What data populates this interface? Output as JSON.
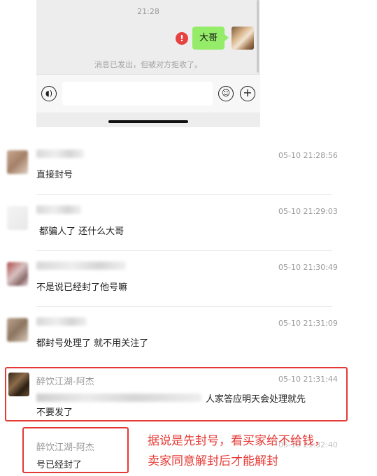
{
  "chat_preview": {
    "time": "21:28",
    "message": "大哥",
    "reject_note": "消息已发出，但被对方拒收了。",
    "icons": [
      "warning-icon",
      "voice-icon",
      "emoji-icon",
      "plus-icon"
    ]
  },
  "comments": [
    {
      "name": "",
      "time": "05-10 21:28:56",
      "text": "直接封号"
    },
    {
      "name": "",
      "time": "05-10 21:29:03",
      "text": "都骗人了 还什么大哥"
    },
    {
      "name": "",
      "time": "05-10 21:30:49",
      "text": "不是说已经封了他号嘛"
    },
    {
      "name": "",
      "time": "05-10 21:31:09",
      "text": "都封号处理了 就不用关注了"
    },
    {
      "name": "醉饮江湖-阿杰",
      "time": "05-10 21:31:44",
      "text_visible": "人家答应明天会处理就先",
      "text_line2": "不要发了"
    },
    {
      "name": "醉饮江湖-阿杰",
      "time": "05-10 21:32:40",
      "text": "号已经封了"
    }
  ],
  "annotation": {
    "line1": "据说是先封号，看买家给不给钱，",
    "line2": "卖家同意解封后才能解封"
  },
  "colors": {
    "highlight": "#e53935",
    "bubble": "#95ec69"
  }
}
